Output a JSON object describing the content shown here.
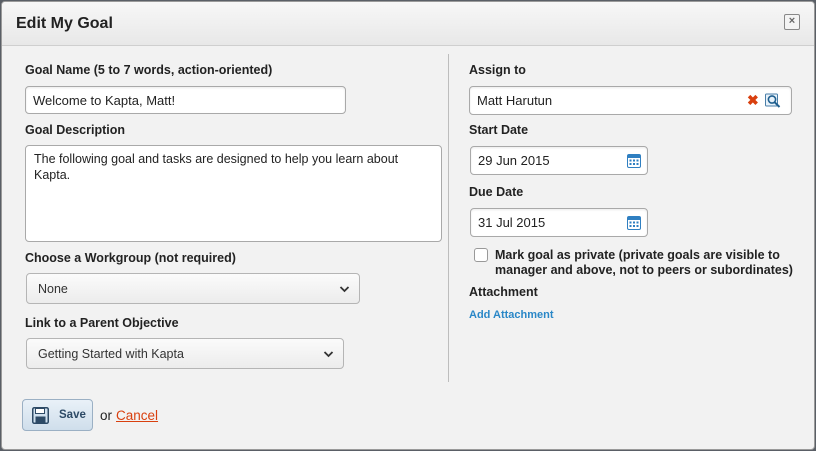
{
  "dialog": {
    "title": "Edit My Goal",
    "close_icon": "close-icon"
  },
  "left": {
    "goal_name_label": "Goal Name (5 to 7 words, action-oriented)",
    "goal_name_value": "Welcome to Kapta, Matt!",
    "goal_description_label": "Goal Description",
    "goal_description_value": "The following goal and tasks are designed to help you learn about Kapta.",
    "workgroup_label": "Choose a Workgroup (not required)",
    "workgroup_value": "None",
    "parent_objective_label": "Link to a Parent Objective",
    "parent_objective_value": "Getting Started with Kapta"
  },
  "right": {
    "assign_to_label": "Assign to",
    "assign_to_value": "Matt Harutun",
    "clear_icon": "clear-x-icon",
    "lookup_icon": "lookup-search-icon",
    "start_date_label": "Start Date",
    "start_date_value": "29 Jun 2015",
    "due_date_label": "Due Date",
    "due_date_value": "31 Jul 2015",
    "calendar_icon": "calendar-icon",
    "private_checkbox_checked": false,
    "private_label": "Mark goal as private (private goals are visible to manager and above, not to peers or subordinates)",
    "attachment_label": "Attachment",
    "add_attachment_link": "Add Attachment"
  },
  "footer": {
    "save_label": "Save",
    "save_icon": "floppy-disk-icon",
    "or_text": "or",
    "cancel_label": "Cancel"
  },
  "colors": {
    "accent_link": "#2a87c7",
    "cancel_link": "#d9400f",
    "clear_x": "#d9400f",
    "calendar_blue": "#2f7fc1"
  }
}
